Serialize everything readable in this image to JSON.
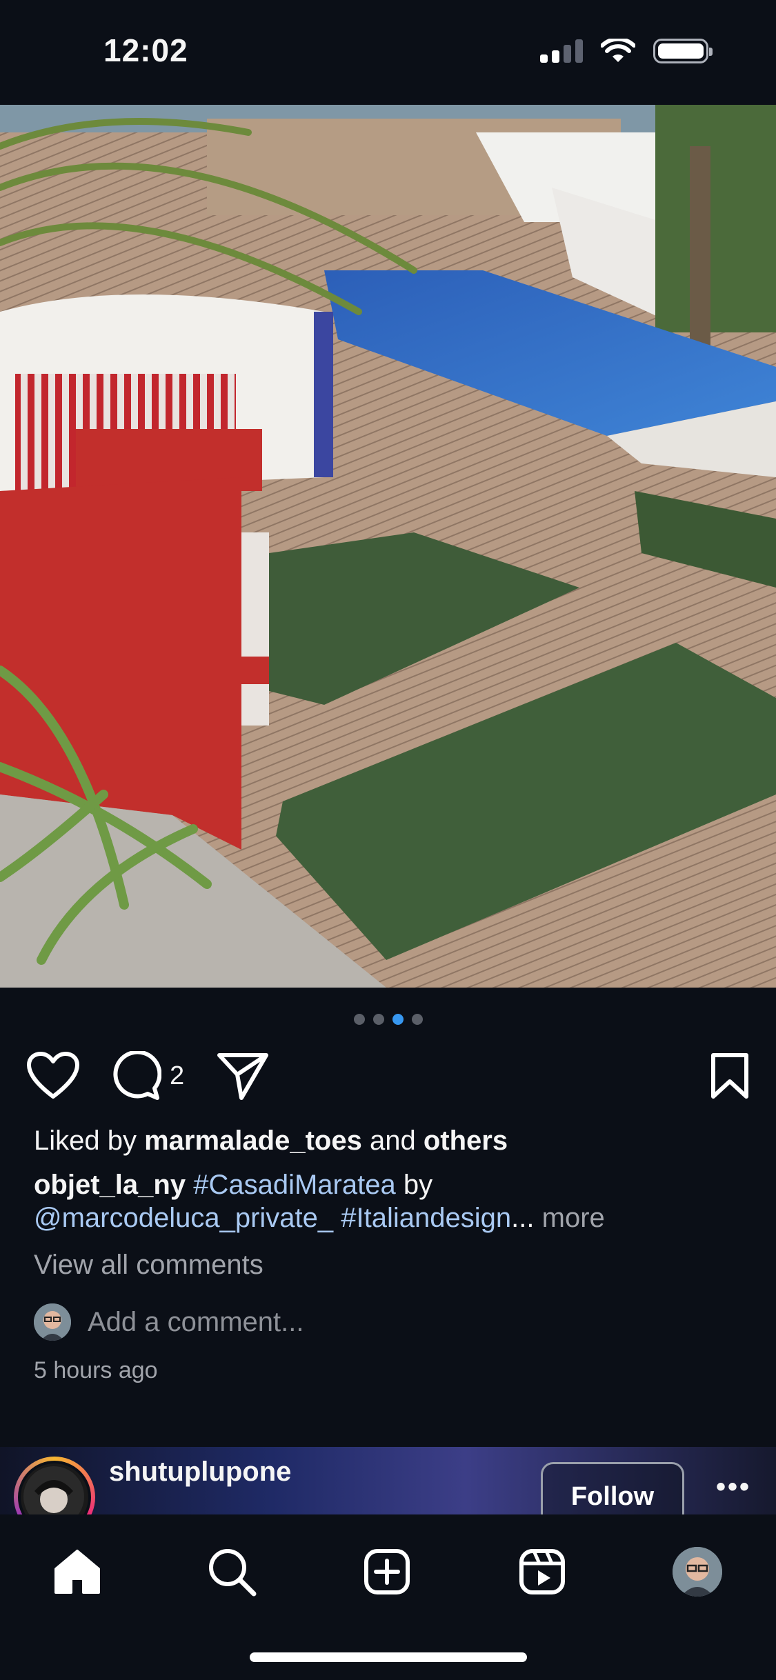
{
  "status_bar": {
    "time": "12:02"
  },
  "post": {
    "carousel": {
      "count": 4,
      "active_index": 2
    },
    "comment_count": "2",
    "liked_prefix": "Liked by ",
    "liked_user": "marmalade_toes",
    "liked_and": " and ",
    "liked_others": "others",
    "caption": {
      "username": "objet_la_ny",
      "hashtag1": "#CasadiMaratea",
      "by": "by",
      "mention": "@marcodeluca_private_",
      "hashtag2": "#Italiandesign",
      "ellipsis": "...",
      "more": "more"
    },
    "view_comments": "View all comments",
    "add_comment_placeholder": "Add a comment...",
    "timestamp": "5 hours ago"
  },
  "next_post": {
    "username": "shutuplupone",
    "follow_label": "Follow",
    "more_label": "•••"
  },
  "tabs": [
    "home",
    "search",
    "create",
    "reels",
    "profile"
  ],
  "colors": {
    "background": "#0b0f17",
    "accent": "#3797f0",
    "link": "#a9c9f2"
  }
}
